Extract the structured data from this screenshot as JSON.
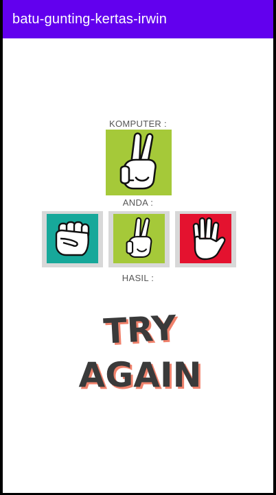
{
  "app": {
    "title": "batu-gunting-kertas-irwin"
  },
  "computer": {
    "label": "KOMPUTER :",
    "choice": "scissors",
    "icon": "peace-hand-icon",
    "tile_color": "#a5c939"
  },
  "player": {
    "label": "ANDA :",
    "options": [
      {
        "name": "rock",
        "icon": "fist-icon",
        "color": "#17a89a"
      },
      {
        "name": "scissors",
        "icon": "peace-hand-icon",
        "color": "#a5c939"
      },
      {
        "name": "paper",
        "icon": "open-hand-icon",
        "color": "#e4122f"
      }
    ]
  },
  "result": {
    "label": "HASIL :",
    "line1": "TRY",
    "line2": "AGAIN",
    "text_color": "#3a3a3a",
    "shadow_color": "#f0826c"
  },
  "colors": {
    "appbar": "#6200ee",
    "button_frame": "#d8d8d8"
  }
}
